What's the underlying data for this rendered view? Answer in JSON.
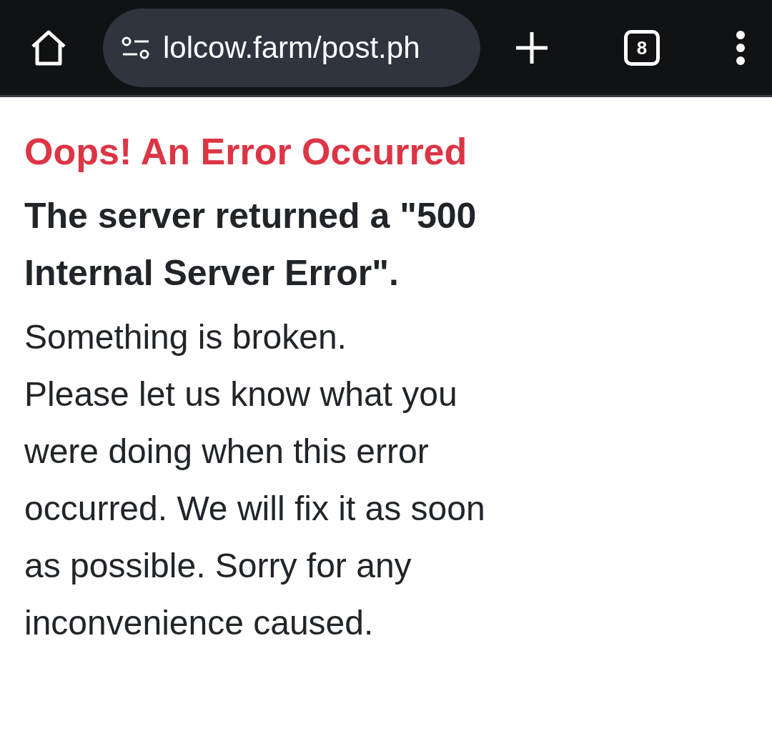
{
  "browser_bar": {
    "url": "lolcow.farm/post.ph",
    "tab_count": "8"
  },
  "error": {
    "title": "Oops! An Error Occurred",
    "heading": "The server returned a \"500 Internal Server Error\".",
    "paragraphs": [
      "Something is broken.",
      "Please let us know what you were doing when this error occurred. We will fix it as soon as possible. Sorry for any inconvenience caused."
    ]
  }
}
